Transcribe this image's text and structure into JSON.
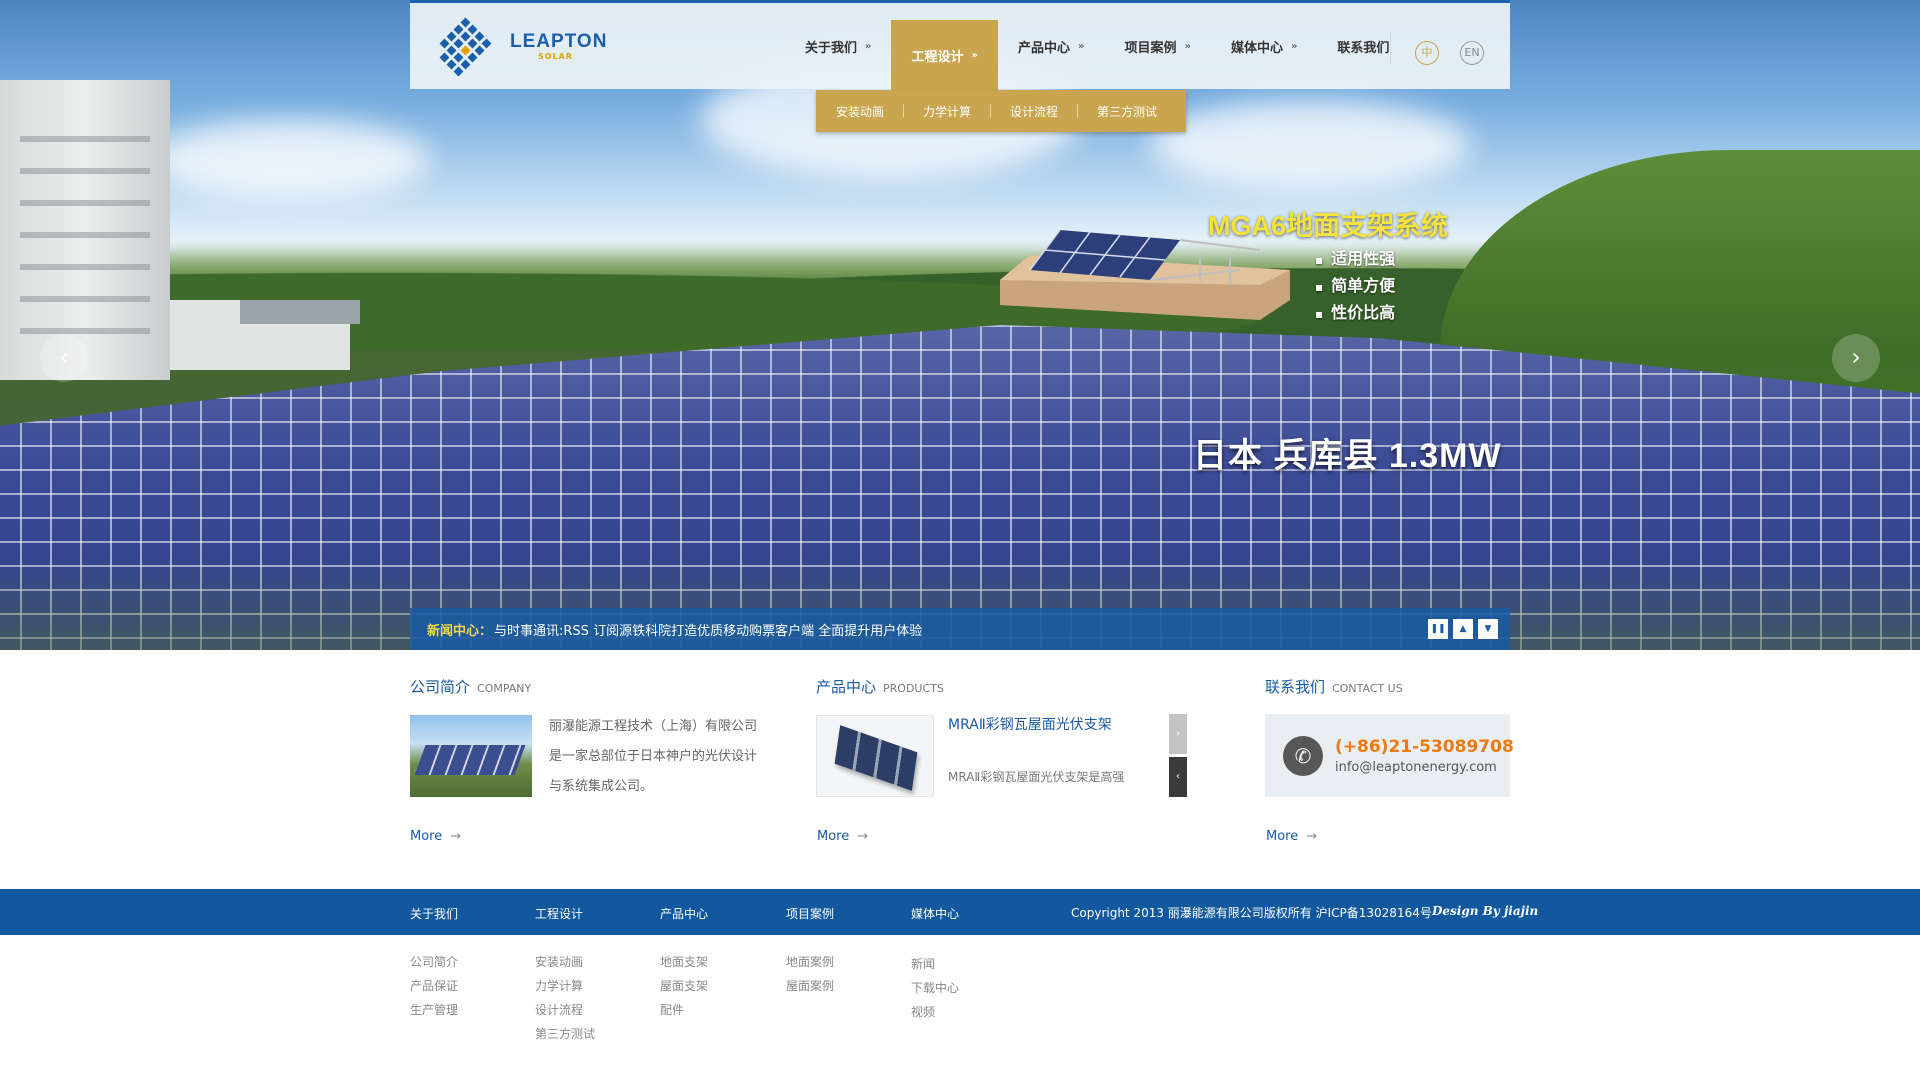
{
  "header": {
    "logo_text": "LEAPTON",
    "logo_sub": "SOLAR",
    "nav": [
      {
        "label": "关于我们",
        "arrow": "»"
      },
      {
        "label": "工程设计",
        "arrow": "»"
      },
      {
        "label": "产品中心",
        "arrow": "»"
      },
      {
        "label": "项目案例",
        "arrow": "»"
      },
      {
        "label": "媒体中心",
        "arrow": "»"
      },
      {
        "label": "联系我们"
      }
    ],
    "lang_zh": "中",
    "lang_en": "EN",
    "submenu": [
      "安装动画",
      "力学计算",
      "设计流程",
      "第三方测试"
    ]
  },
  "hero": {
    "promo_title": "MGA6地面支架系统",
    "promo_bullets": [
      "适用性强",
      "简单方便",
      "性价比高"
    ],
    "caption": "日本 兵库县 1.3MW",
    "prev_icon": "‹",
    "next_icon": "›"
  },
  "news": {
    "label": "新闻中心：",
    "text": "与时事通讯:RSS 订阅源铁科院打造优质移动购票客户端 全面提升用户体验",
    "pause_icon": "❚❚",
    "up_icon": "▲",
    "down_icon": "▼"
  },
  "company": {
    "title_zh": "公司简介",
    "title_en": "COMPANY",
    "text": "丽瀑能源工程技术（上海）有限公司是一家总部位于日本神户的光伏设计与系统集成公司。",
    "more": "More",
    "more_arrow": "→"
  },
  "products": {
    "title_zh": "产品中心",
    "title_en": "PRODUCTS",
    "item_title": "MRAⅡ彩钢瓦屋面光伏支架",
    "item_desc": "MRAⅡ彩钢瓦屋面光伏支架是高强",
    "scroll_up": "›",
    "scroll_down": "‹",
    "more": "More",
    "more_arrow": "→"
  },
  "contact": {
    "title_zh": "联系我们",
    "title_en": "CONTACT US",
    "phone_icon": "✆",
    "phone": "(+86)21-53089708",
    "email": "info@leaptonenergy.com",
    "more": "More",
    "more_arrow": "→"
  },
  "footer": {
    "columns": [
      {
        "head": "关于我们",
        "items": [
          "公司简介",
          "产品保证",
          "生产管理"
        ]
      },
      {
        "head": "工程设计",
        "items": [
          "安装动画",
          "力学计算",
          "设计流程",
          "第三方测试"
        ]
      },
      {
        "head": "产品中心",
        "items": [
          "地面支架",
          "屋面支架",
          "配件"
        ]
      },
      {
        "head": "项目案例",
        "items": [
          "地面案例",
          "屋面案例"
        ]
      },
      {
        "head": "媒体中心",
        "items": [
          "新闻",
          "下载中心",
          "视频"
        ]
      }
    ],
    "copyright": "Copyright 2013 丽瀑能源有限公司版权所有 沪ICP备13028164号",
    "design_by": "Design By jiajin"
  },
  "colors": {
    "brand_blue": "#1a5aa0",
    "nav_gold": "#c8a54e",
    "promo_yellow": "#f4e33b",
    "phone_orange": "#ec7a12",
    "footer_blue": "#12589e"
  }
}
